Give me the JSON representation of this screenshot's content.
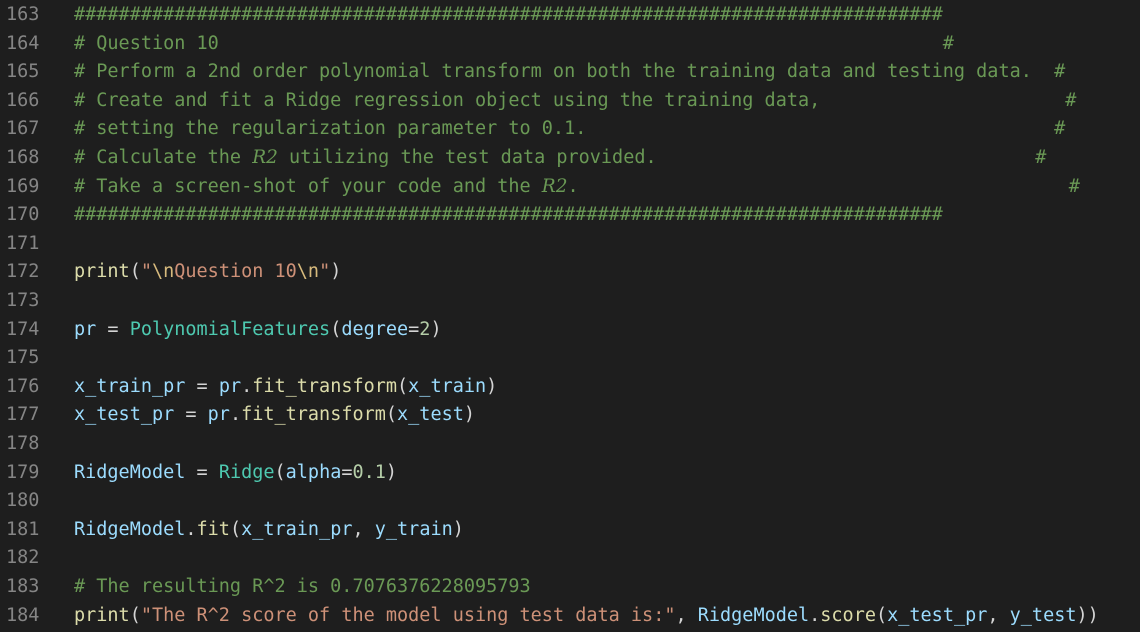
{
  "editor": {
    "lines": [
      {
        "num": "163",
        "tokens": [
          {
            "t": "##############################################################################",
            "c": "c"
          }
        ]
      },
      {
        "num": "164",
        "tokens": [
          {
            "t": "# Question 10                                                                 #",
            "c": "c"
          }
        ]
      },
      {
        "num": "165",
        "tokens": [
          {
            "t": "# Perform a 2nd order polynomial transform on both the training data and testing data.  #",
            "c": "c"
          }
        ]
      },
      {
        "num": "166",
        "tokens": [
          {
            "t": "# Create and fit a Ridge regression object using the training data,                      #",
            "c": "c"
          }
        ]
      },
      {
        "num": "167",
        "tokens": [
          {
            "t": "# setting the regularization parameter to 0.1.                                          #",
            "c": "c"
          }
        ]
      },
      {
        "num": "168",
        "tokens": [
          {
            "t": "# Calculate the ",
            "c": "c"
          },
          {
            "t": "R2",
            "c": "c it"
          },
          {
            "t": " utilizing the test data provided.                                  #",
            "c": "c"
          }
        ]
      },
      {
        "num": "169",
        "tokens": [
          {
            "t": "# Take a screen-shot of your code and the ",
            "c": "c"
          },
          {
            "t": "R2",
            "c": "c it"
          },
          {
            "t": ".                                            #",
            "c": "c"
          }
        ]
      },
      {
        "num": "170",
        "tokens": [
          {
            "t": "##############################################################################",
            "c": "c"
          }
        ]
      },
      {
        "num": "171",
        "tokens": []
      },
      {
        "num": "172",
        "tokens": [
          {
            "t": "print",
            "c": "f"
          },
          {
            "t": "(",
            "c": "p"
          },
          {
            "t": "\"",
            "c": "s"
          },
          {
            "t": "\\n",
            "c": "e"
          },
          {
            "t": "Question 10",
            "c": "s"
          },
          {
            "t": "\\n",
            "c": "e"
          },
          {
            "t": "\"",
            "c": "s"
          },
          {
            "t": ")",
            "c": "p"
          }
        ]
      },
      {
        "num": "173",
        "tokens": []
      },
      {
        "num": "174",
        "tokens": [
          {
            "t": "pr",
            "c": "v"
          },
          {
            "t": " = ",
            "c": "p"
          },
          {
            "t": "PolynomialFeatures",
            "c": "t"
          },
          {
            "t": "(",
            "c": "p"
          },
          {
            "t": "degree",
            "c": "v"
          },
          {
            "t": "=",
            "c": "p"
          },
          {
            "t": "2",
            "c": "n"
          },
          {
            "t": ")",
            "c": "p"
          }
        ]
      },
      {
        "num": "175",
        "tokens": []
      },
      {
        "num": "176",
        "tokens": [
          {
            "t": "x_train_pr",
            "c": "v"
          },
          {
            "t": " = ",
            "c": "p"
          },
          {
            "t": "pr",
            "c": "v"
          },
          {
            "t": ".",
            "c": "p"
          },
          {
            "t": "fit_transform",
            "c": "f"
          },
          {
            "t": "(",
            "c": "p"
          },
          {
            "t": "x_train",
            "c": "v"
          },
          {
            "t": ")",
            "c": "p"
          }
        ]
      },
      {
        "num": "177",
        "tokens": [
          {
            "t": "x_test_pr",
            "c": "v"
          },
          {
            "t": " = ",
            "c": "p"
          },
          {
            "t": "pr",
            "c": "v"
          },
          {
            "t": ".",
            "c": "p"
          },
          {
            "t": "fit_transform",
            "c": "f"
          },
          {
            "t": "(",
            "c": "p"
          },
          {
            "t": "x_test",
            "c": "v"
          },
          {
            "t": ")",
            "c": "p"
          }
        ]
      },
      {
        "num": "178",
        "tokens": []
      },
      {
        "num": "179",
        "tokens": [
          {
            "t": "RidgeModel",
            "c": "v"
          },
          {
            "t": " = ",
            "c": "p"
          },
          {
            "t": "Ridge",
            "c": "t"
          },
          {
            "t": "(",
            "c": "p"
          },
          {
            "t": "alpha",
            "c": "v"
          },
          {
            "t": "=",
            "c": "p"
          },
          {
            "t": "0.1",
            "c": "n"
          },
          {
            "t": ")",
            "c": "p"
          }
        ]
      },
      {
        "num": "180",
        "tokens": []
      },
      {
        "num": "181",
        "tokens": [
          {
            "t": "RidgeModel",
            "c": "v"
          },
          {
            "t": ".",
            "c": "p"
          },
          {
            "t": "fit",
            "c": "f"
          },
          {
            "t": "(",
            "c": "p"
          },
          {
            "t": "x_train_pr",
            "c": "v"
          },
          {
            "t": ", ",
            "c": "p"
          },
          {
            "t": "y_train",
            "c": "v"
          },
          {
            "t": ")",
            "c": "p"
          }
        ]
      },
      {
        "num": "182",
        "tokens": []
      },
      {
        "num": "183",
        "tokens": [
          {
            "t": "# The resulting R^2 is 0.7076376228095793",
            "c": "c"
          }
        ]
      },
      {
        "num": "184",
        "tokens": [
          {
            "t": "print",
            "c": "f"
          },
          {
            "t": "(",
            "c": "p"
          },
          {
            "t": "\"The R^2 score of the model using test data is:\"",
            "c": "s"
          },
          {
            "t": ", ",
            "c": "p"
          },
          {
            "t": "RidgeModel",
            "c": "v"
          },
          {
            "t": ".",
            "c": "p"
          },
          {
            "t": "score",
            "c": "f"
          },
          {
            "t": "(",
            "c": "p"
          },
          {
            "t": "x_test_pr",
            "c": "v"
          },
          {
            "t": ", ",
            "c": "p"
          },
          {
            "t": "y_test",
            "c": "v"
          },
          {
            "t": "))",
            "c": "p"
          }
        ]
      }
    ]
  },
  "colors": {
    "background": "#1e1e1e",
    "line_number": "#858585",
    "comment": "#6a9955",
    "function": "#dcdcaa",
    "string": "#ce9178",
    "escape": "#d7ba7d",
    "variable": "#9cdcfe",
    "class": "#4ec9b0",
    "number": "#b5cea8",
    "punctuation": "#d4d4d4"
  }
}
